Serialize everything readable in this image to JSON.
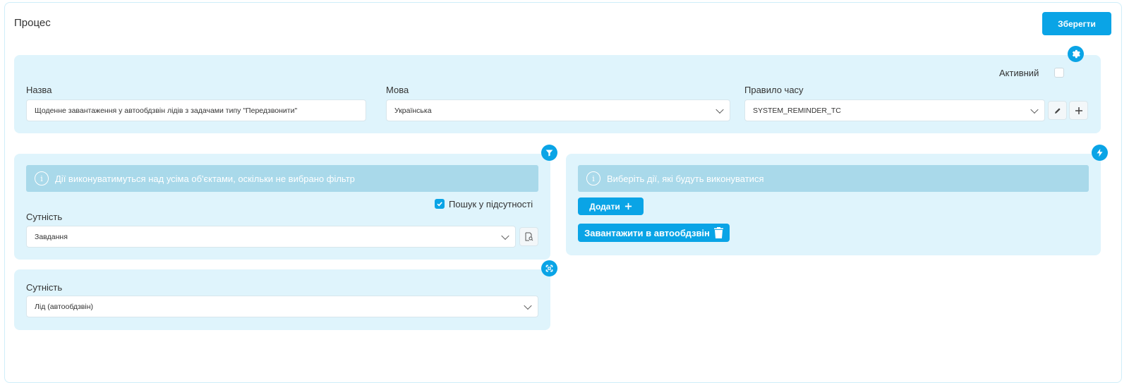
{
  "page": {
    "title": "Процес"
  },
  "toolbar": {
    "save_label": "Зберегти"
  },
  "settings_panel": {
    "active_label": "Активний",
    "active_checked": false,
    "name": {
      "label": "Назва",
      "value": "Щоденне завантаження у автообдзвін лідів з задачами типу \"Передзвонити\""
    },
    "language": {
      "label": "Мова",
      "value": "Українська"
    },
    "time_rule": {
      "label": "Правило часу",
      "value": "SYSTEM_REMINDER_TC"
    }
  },
  "filter_panel": {
    "info_text": "Дії виконуватимуться над усіма об'єктами, оскільки не вибрано фільтр",
    "search_absence_label": "Пошук у підсутності",
    "search_absence_checked": true,
    "entity": {
      "label": "Сутність",
      "value": "Завдання"
    }
  },
  "entity_panel": {
    "entity": {
      "label": "Сутність",
      "value": "Лід (автообдзвін)"
    }
  },
  "actions_panel": {
    "info_text": "Виберіть дії, які будуть виконуватися",
    "add_label": "Додати",
    "autodial_label": "Завантажити в автообдзвін"
  },
  "icons": {
    "settings": "gear-icon",
    "filter": "filter-icon",
    "actions": "lightning-icon",
    "entity": "focus-icon",
    "edit": "pencil-icon",
    "add": "plus-icon",
    "delete": "trash-icon",
    "info": "info-icon",
    "search_doc": "document-search-icon"
  },
  "colors": {
    "accent": "#0aa4e6",
    "panel_bg": "#dff4fc",
    "info_bg": "#a9d9ea"
  }
}
